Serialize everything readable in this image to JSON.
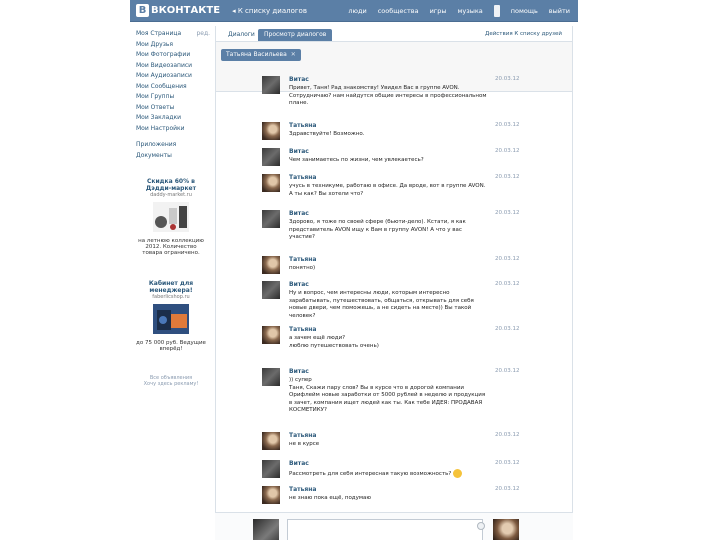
{
  "header": {
    "logo_text": "ВКОНТАКТЕ",
    "logo_letter": "В",
    "back_link": "К списку диалогов",
    "nav": [
      "люди",
      "сообщества",
      "игры",
      "музыка",
      "помощь",
      "выйти"
    ]
  },
  "left_menu": {
    "items": [
      {
        "label": "Моя Страница",
        "extra": "ред."
      },
      {
        "label": "Мои Друзья",
        "extra": ""
      },
      {
        "label": "Мои Фотографии",
        "extra": ""
      },
      {
        "label": "Мои Видеозаписи",
        "extra": ""
      },
      {
        "label": "Мои Аудиозаписи",
        "extra": ""
      },
      {
        "label": "Мои Сообщения",
        "extra": ""
      },
      {
        "label": "Мои Группы",
        "extra": ""
      },
      {
        "label": "Мои Ответы",
        "extra": ""
      },
      {
        "label": "Мои Закладки",
        "extra": ""
      },
      {
        "label": "Мои Настройки",
        "extra": ""
      }
    ],
    "extra_items": [
      "Приложения",
      "Документы"
    ]
  },
  "ads": [
    {
      "title": "Скидка 60% в Дэдди-маркет",
      "sub": "daddy-market.ru",
      "text": "на летнюю коллекцию 2012. Количество товара ограничено."
    },
    {
      "title": "Кабинет для менеджера!",
      "sub": "faberlicshop.ru",
      "text": "до 75 000 руб. Ведущие вперёд!"
    }
  ],
  "ads_footer": [
    "Все объявления",
    "Хочу здесь рекламу!"
  ],
  "tabs": {
    "dialogs": "Диалоги",
    "view_dialogs": "Просмотр диалогов",
    "actions": "Действия   К списку друзей"
  },
  "filter": {
    "chip": "Татьяна Васильева"
  },
  "messages": [
    {
      "author": "Витас",
      "date": "20.03.12",
      "avatar": "dark",
      "text": "Привет, Таня! Рад знакомству! Увидел Вас в группе AVON. Сотрудничаю? нам найдутся общие интересы в профессиональном плане."
    },
    {
      "author": "Татьяна",
      "date": "20.03.12",
      "avatar": "photo",
      "text": "Здравствуйте! Возможно."
    },
    {
      "author": "Витас",
      "date": "20.03.12",
      "avatar": "dark",
      "text": "Чем занимаетесь по жизни, чем увлекаетесь?"
    },
    {
      "author": "Татьяна",
      "date": "20.03.12",
      "avatar": "photo",
      "text": "учусь в техникуме, работаю в офисе. Да вроде, вот в группе AVON. А ты как? Вы хотели что?"
    },
    {
      "author": "Витас",
      "date": "20.03.12",
      "avatar": "dark",
      "text": "Здорово, я тоже по своей сфере (бьюти-дело). Кстати, я как представитель AVON ищу к Вам в группу AVON! А что у вас участие?"
    },
    {
      "author": "Татьяна",
      "date": "20.03.12",
      "avatar": "photo",
      "text": "понятно)"
    },
    {
      "author": "Витас",
      "date": "20.03.12",
      "avatar": "dark",
      "text": "Ну и вопрос, чем интересны люди, которым интересно зарабатывать, путешествовать, общаться, открывать для себя новые двери, чем поможешь, а не сидеть на месте)) Вы такой человек?"
    },
    {
      "author": "Татьяна",
      "date": "20.03.12",
      "avatar": "photo",
      "text": "а зачем ещё люди?\nлюблю путешествовать очень)"
    },
    {
      "author": "Витас",
      "date": "20.03.12",
      "avatar": "dark",
      "text": ")) супер\nТаня, Скажи пару слов? Вы в курсе что в дорогой компании Орифлейм новые заработки от 5000 рублей в неделю и продукция в зачет, компания ищет людей как ты. Как тебе ИДЕЯ: ПРОДАВАЯ КОСМЕТИКУ?"
    },
    {
      "author": "Татьяна",
      "date": "20.03.12",
      "avatar": "photo",
      "text": "не в курсе"
    },
    {
      "author": "Витас",
      "date": "20.03.12",
      "avatar": "dark",
      "text": "Рассмотреть для себя интересная такую возможность?"
    },
    {
      "author": "Татьяна",
      "date": "20.03.12",
      "avatar": "photo",
      "text": "не знаю пока ещё, подумаю"
    }
  ],
  "colors": {
    "header": "#5b7fa6",
    "link": "#2b587a",
    "muted": "#8a9bb0"
  }
}
